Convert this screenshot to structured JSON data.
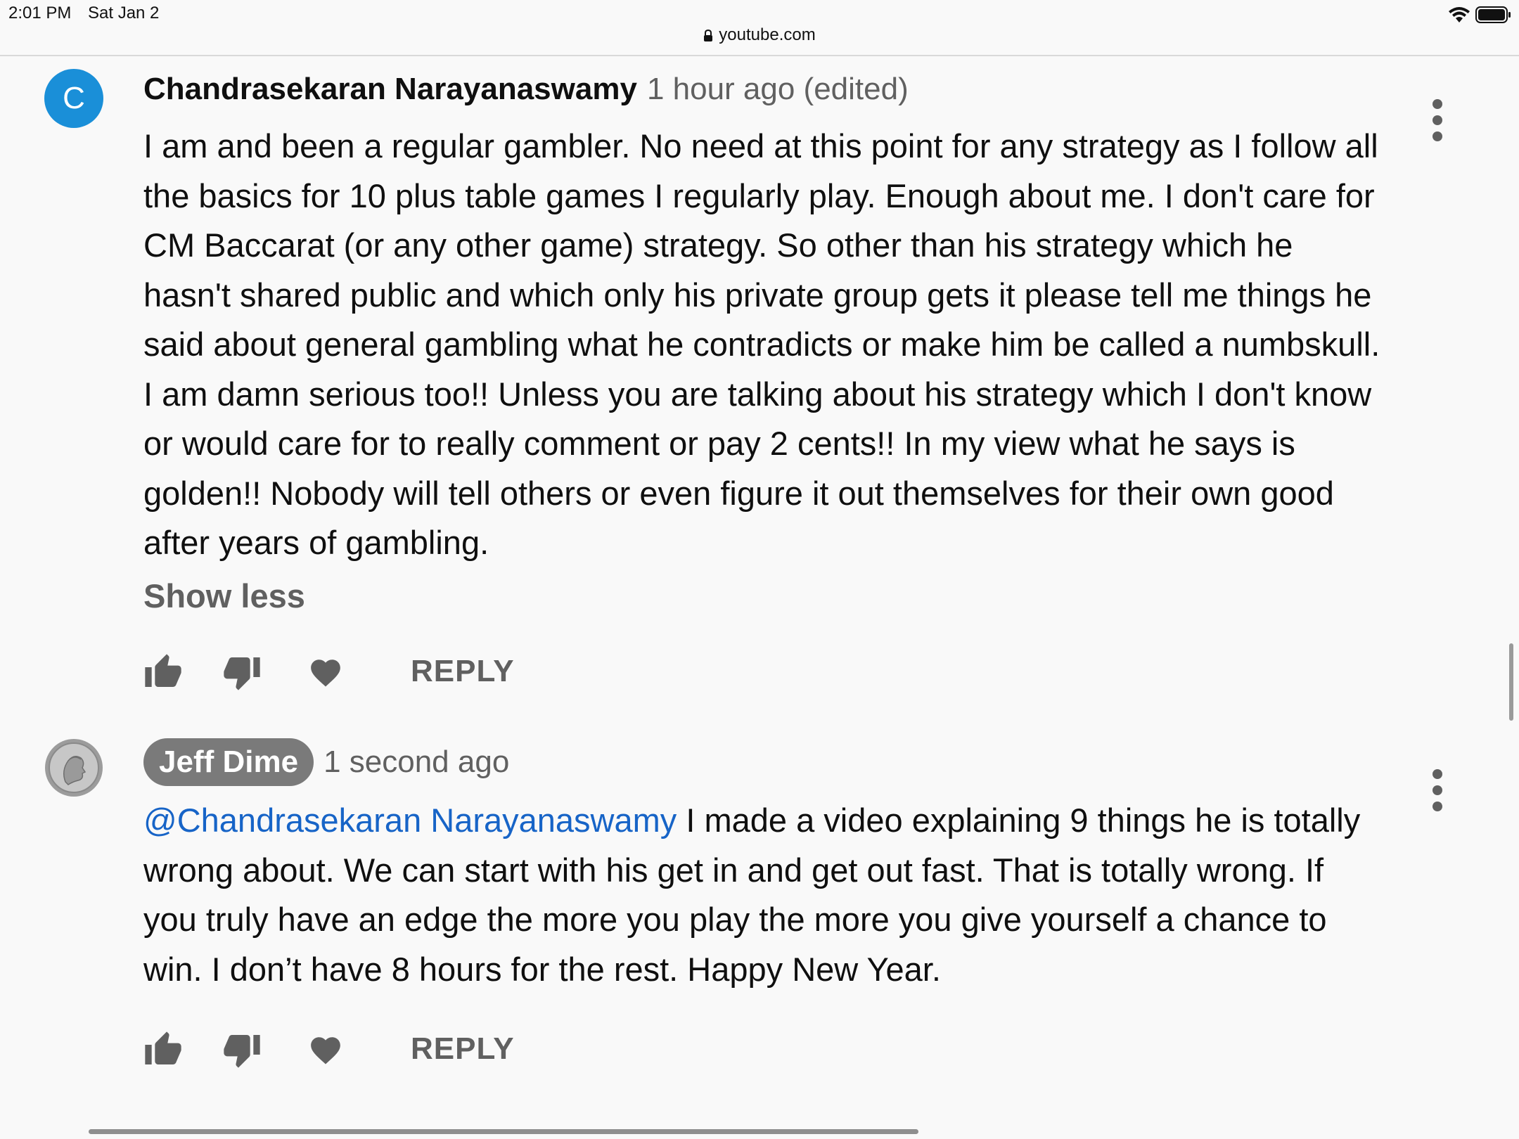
{
  "status_bar": {
    "time": "2:01 PM",
    "date": "Sat Jan 2",
    "url": "youtube.com"
  },
  "comments": [
    {
      "avatar_letter": "C",
      "avatar_color": "#1a8fd8",
      "author": "Chandrasekaran Narayanaswamy",
      "meta": "1 hour ago (edited)",
      "text": "I am and been a regular gambler. No need at this point for any strategy as I follow all the basics for 10 plus table games I regularly play. Enough about me. I don't care for CM Baccarat (or any other game) strategy. So other than his strategy which he hasn't shared public and which only his private group gets it please tell me things he said about general gambling what he contradicts or make him be called a numbskull. I am damn serious too!! Unless you are talking about his strategy which I don't know or would care for to really comment or pay 2 cents!! In my view what he says is golden!! Nobody will tell others or even figure it out themselves for their own good after years of gambling.",
      "show_less": "Show less",
      "reply_label": "REPLY"
    },
    {
      "author": "Jeff Dime",
      "meta": "1 second ago",
      "mention": "@Chandrasekaran Narayanaswamy",
      "text": " I made a video explaining 9 things he is totally wrong about.  We can start with his get in and get out fast.  That is totally wrong.   If you truly have an edge the more you play the more you give yourself a chance to win.  I don’t have 8 hours for the rest.  Happy New Year.",
      "reply_label": "REPLY"
    }
  ]
}
